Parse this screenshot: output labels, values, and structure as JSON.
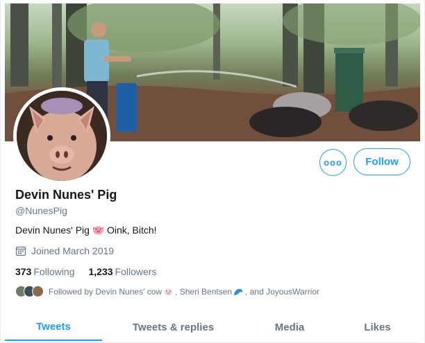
{
  "profile": {
    "display_name": "Devin Nunes' Pig",
    "handle": "@NunesPig",
    "bio_prefix": "Devin Nunes' Pig",
    "bio_emoji": "pig-face-emoji",
    "bio_suffix": "Oink, Bitch!",
    "joined": "Joined March 2019"
  },
  "actions": {
    "more_label": "ooo",
    "follow_label": "Follow"
  },
  "stats": {
    "following_count": "373",
    "following_label": "Following",
    "followers_count": "1,233",
    "followers_label": "Followers"
  },
  "followed_by": {
    "prefix": "Followed by Devin Nunes' cow",
    "name_2": ", Sheri Bentsen",
    "suffix": ", and JoyousWarrior"
  },
  "tabs": [
    {
      "label": "Tweets",
      "active": true
    },
    {
      "label": "Tweets & replies",
      "active": false
    },
    {
      "label": "Media",
      "active": false
    },
    {
      "label": "Likes",
      "active": false
    }
  ],
  "colors": {
    "accent": "#1da1f2",
    "text_primary": "#14171a",
    "text_secondary": "#657786"
  },
  "icons": {
    "calendar": "calendar-icon",
    "more": "more-icon"
  }
}
